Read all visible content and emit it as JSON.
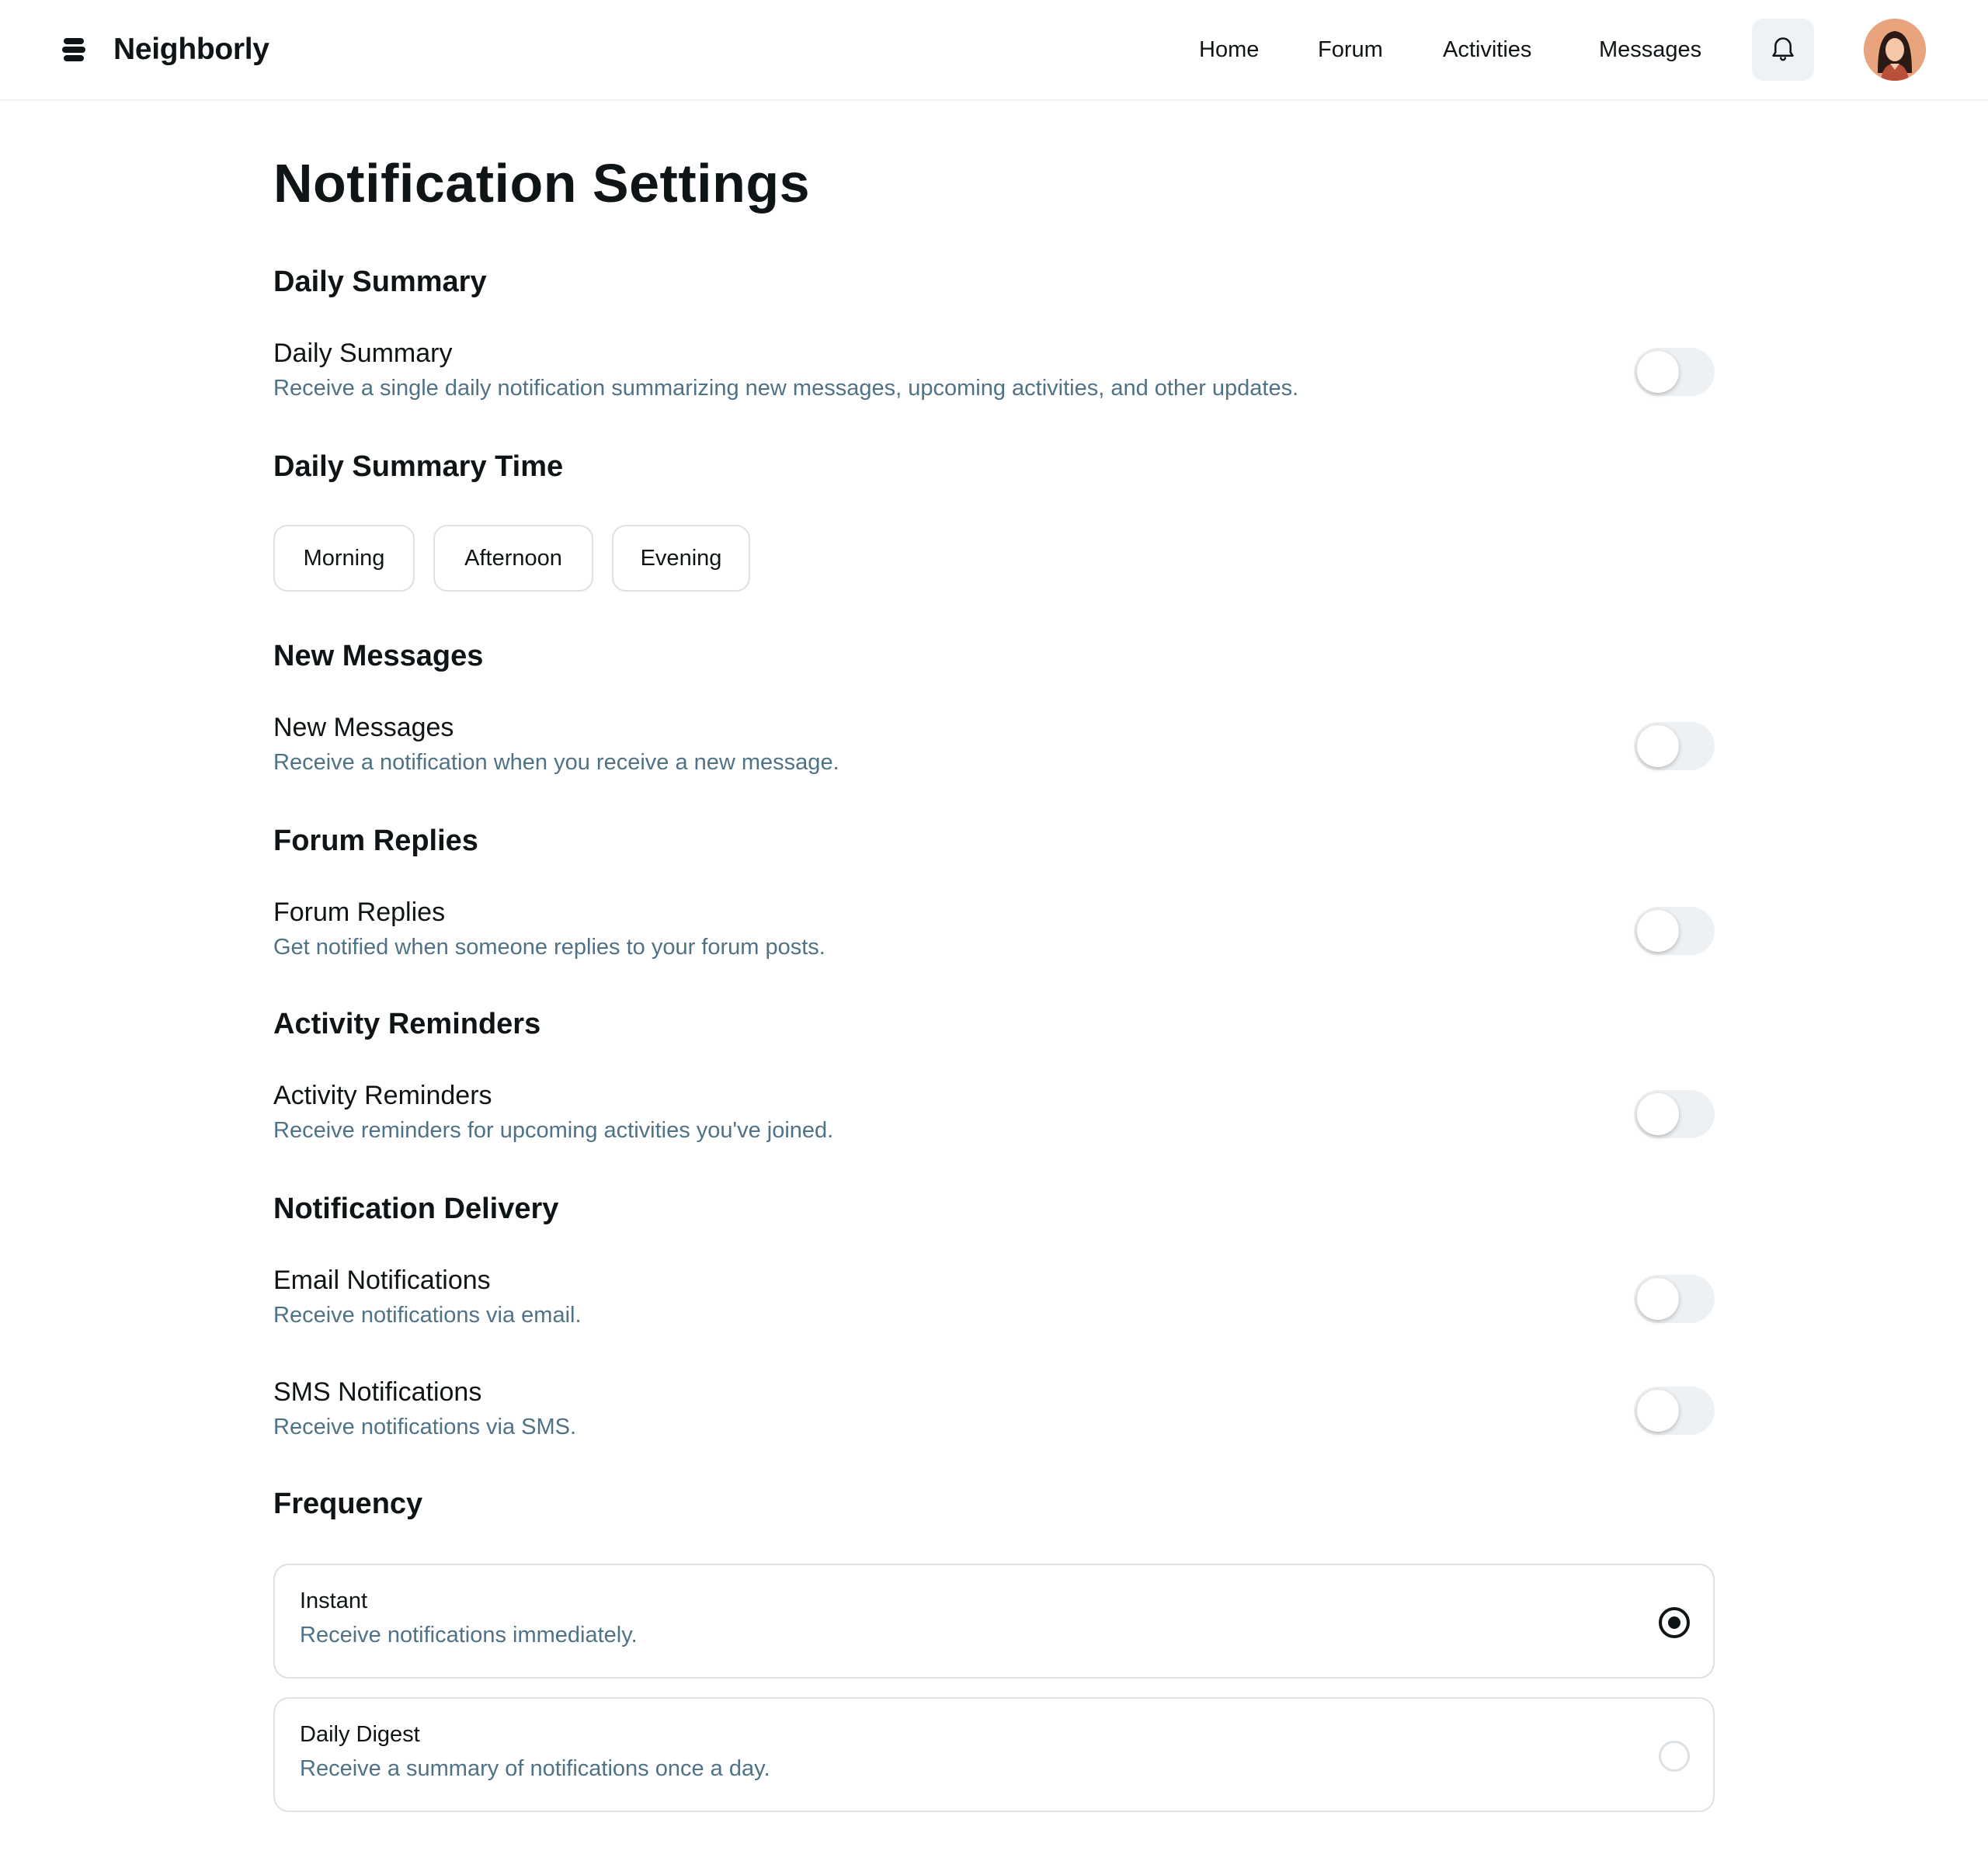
{
  "app": {
    "name": "Neighborly"
  },
  "nav": {
    "items": [
      "Home",
      "Forum",
      "Activities",
      "Messages"
    ]
  },
  "page": {
    "title": "Notification Settings"
  },
  "sections": {
    "daily_summary": {
      "title": "Daily Summary",
      "label": "Daily Summary",
      "description": "Receive a single daily notification summarizing new messages, upcoming activities, and other updates.",
      "enabled": false
    },
    "daily_summary_time": {
      "title": "Daily Summary Time",
      "options": [
        "Morning",
        "Afternoon",
        "Evening"
      ]
    },
    "new_messages": {
      "title": "New Messages",
      "label": "New Messages",
      "description": "Receive a notification when you receive a new message.",
      "enabled": false
    },
    "forum_replies": {
      "title": "Forum Replies",
      "label": "Forum Replies",
      "description": "Get notified when someone replies to your forum posts.",
      "enabled": false
    },
    "activity_reminders": {
      "title": "Activity Reminders",
      "label": "Activity Reminders",
      "description": "Receive reminders for upcoming activities you've joined.",
      "enabled": false
    },
    "delivery": {
      "title": "Notification Delivery",
      "email": {
        "label": "Email Notifications",
        "description": "Receive notifications via email.",
        "enabled": false
      },
      "sms": {
        "label": "SMS Notifications",
        "description": "Receive notifications via SMS.",
        "enabled": false
      }
    },
    "frequency": {
      "title": "Frequency",
      "options": [
        {
          "label": "Instant",
          "description": "Receive notifications immediately.",
          "selected": true
        },
        {
          "label": "Daily Digest",
          "description": "Receive a summary of notifications once a day.",
          "selected": false
        }
      ]
    }
  },
  "icons": {
    "logo": "stacked-layers-icon",
    "notifications": "bell-icon",
    "avatar": "user-avatar"
  },
  "colors": {
    "text": "#0f1417",
    "muted_text": "#4f7287",
    "border": "#dbe1e5",
    "toggle_off": "#eef1f3",
    "bell_bg": "#eef2f4"
  }
}
